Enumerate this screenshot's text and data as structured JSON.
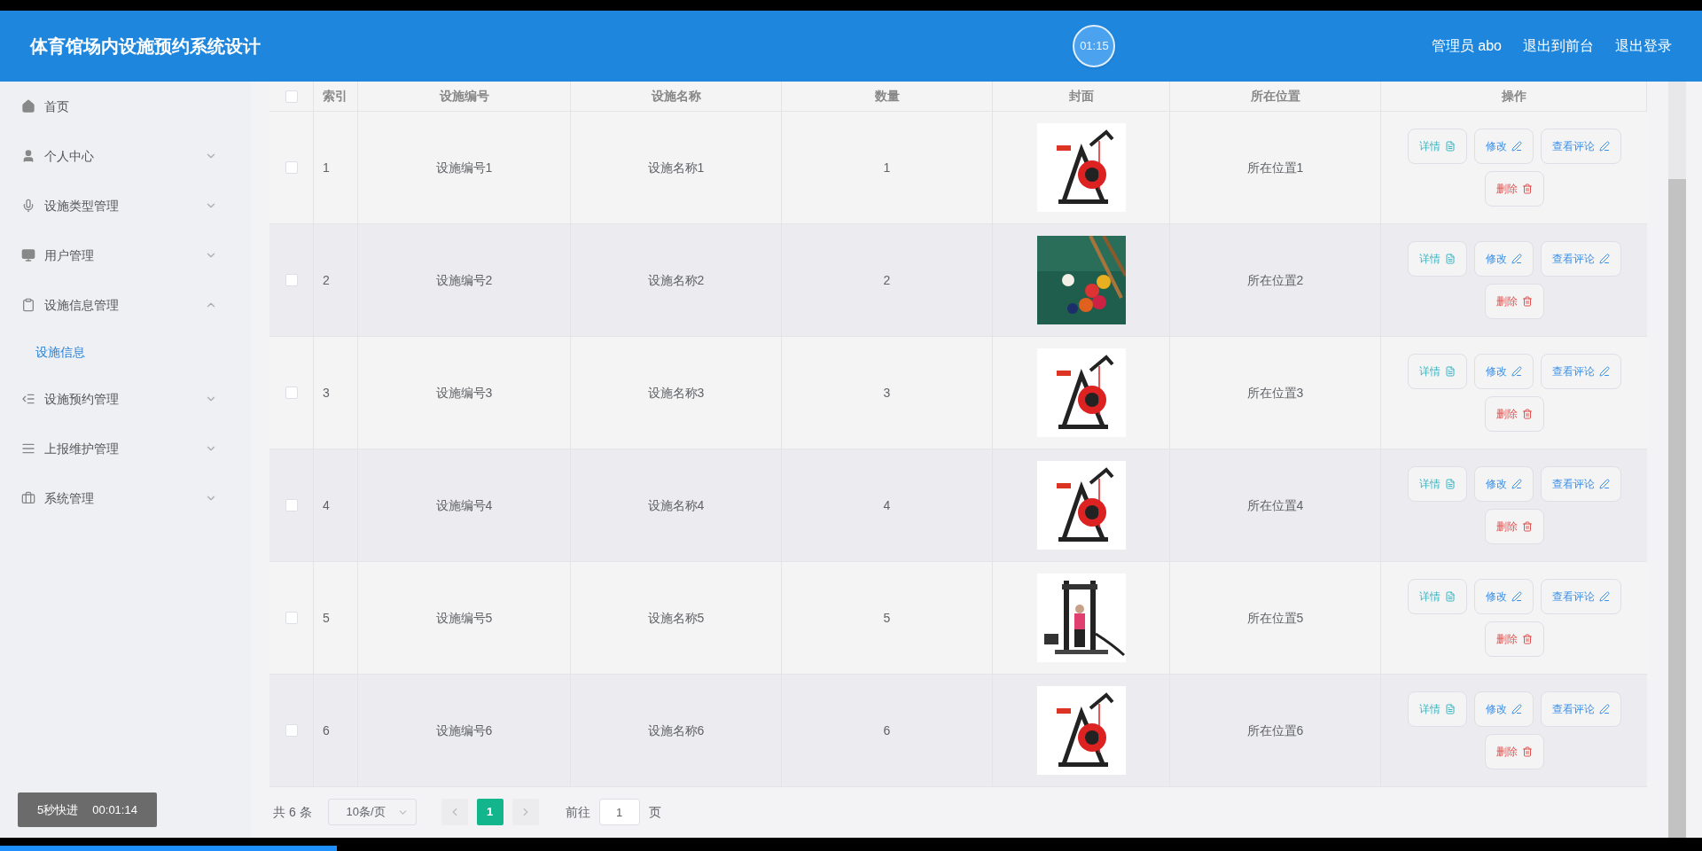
{
  "header": {
    "title": "体育馆场内设施预约系统设计",
    "timer": "01:15",
    "links": [
      "管理员 abo",
      "退出到前台",
      "退出登录"
    ]
  },
  "sidebar": {
    "items": [
      {
        "label": "首页"
      },
      {
        "label": "个人中心",
        "expanded": false
      },
      {
        "label": "设施类型管理",
        "expanded": false
      },
      {
        "label": "用户管理",
        "expanded": false
      },
      {
        "label": "设施信息管理",
        "expanded": true,
        "children": [
          {
            "label": "设施信息",
            "selected": true
          }
        ]
      },
      {
        "label": "设施预约管理",
        "expanded": false
      },
      {
        "label": "上报维护管理",
        "expanded": false
      },
      {
        "label": "系统管理",
        "expanded": false
      }
    ]
  },
  "table": {
    "select_all": {
      "checked": false
    },
    "columns": [
      "索引",
      "设施编号",
      "设施名称",
      "数量",
      "封面",
      "所在位置",
      "操作"
    ],
    "rows": [
      {
        "checked": false,
        "cells": [
          "1",
          "设施编号1",
          "设施名称1",
          "1",
          "",
          "所在位置1"
        ],
        "actions": [
          {
            "label": "详情",
            "kind": "detail"
          },
          {
            "label": "修改",
            "kind": "edit"
          },
          {
            "label": "查看评论",
            "kind": "comment"
          },
          {
            "label": "删除",
            "kind": "delete"
          }
        ]
      },
      {
        "checked": false,
        "cells": [
          "2",
          "设施编号2",
          "设施名称2",
          "2",
          "",
          "所在位置2"
        ],
        "actions": [
          {
            "label": "详情",
            "kind": "detail"
          },
          {
            "label": "修改",
            "kind": "edit"
          },
          {
            "label": "查看评论",
            "kind": "comment"
          },
          {
            "label": "删除",
            "kind": "delete"
          }
        ]
      },
      {
        "checked": false,
        "cells": [
          "3",
          "设施编号3",
          "设施名称3",
          "3",
          "",
          "所在位置3"
        ],
        "actions": [
          {
            "label": "详情",
            "kind": "detail"
          },
          {
            "label": "修改",
            "kind": "edit"
          },
          {
            "label": "查看评论",
            "kind": "comment"
          },
          {
            "label": "删除",
            "kind": "delete"
          }
        ]
      },
      {
        "checked": false,
        "cells": [
          "4",
          "设施编号4",
          "设施名称4",
          "4",
          "",
          "所在位置4"
        ],
        "actions": [
          {
            "label": "详情",
            "kind": "detail"
          },
          {
            "label": "修改",
            "kind": "edit"
          },
          {
            "label": "查看评论",
            "kind": "comment"
          },
          {
            "label": "删除",
            "kind": "delete"
          }
        ]
      },
      {
        "checked": false,
        "cells": [
          "5",
          "设施编号5",
          "设施名称5",
          "5",
          "",
          "所在位置5"
        ],
        "actions": [
          {
            "label": "详情",
            "kind": "detail"
          },
          {
            "label": "修改",
            "kind": "edit"
          },
          {
            "label": "查看评论",
            "kind": "comment"
          },
          {
            "label": "删除",
            "kind": "delete"
          }
        ]
      },
      {
        "checked": false,
        "cells": [
          "6",
          "设施编号6",
          "设施名称6",
          "6",
          "",
          "所在位置6"
        ],
        "actions": [
          {
            "label": "详情",
            "kind": "detail"
          },
          {
            "label": "修改",
            "kind": "edit"
          },
          {
            "label": "查看评论",
            "kind": "comment"
          },
          {
            "label": "删除",
            "kind": "delete"
          }
        ]
      }
    ]
  },
  "pagination": {
    "total": "共 6 条",
    "page_size": "10条/页",
    "pages": [
      {
        "label": "1",
        "selected": true
      }
    ],
    "goto_label": "前往",
    "goto_value": "1",
    "goto_suffix": "页"
  },
  "player": {
    "skip": "5秒快进",
    "time": "00:01:14",
    "progress": {
      "level": 0.198
    }
  }
}
